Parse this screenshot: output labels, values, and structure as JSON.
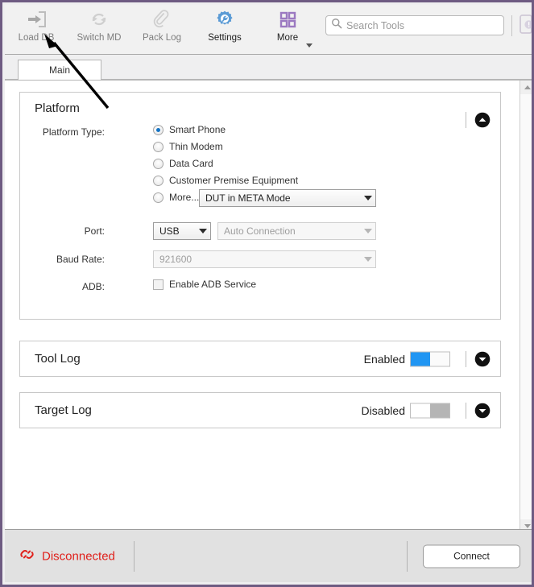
{
  "toolbar": {
    "buttons": [
      {
        "label": "Load DB",
        "icon": "import-db-icon",
        "state": "dim"
      },
      {
        "label": "Switch MD",
        "icon": "refresh-sync-icon",
        "state": "dim"
      },
      {
        "label": "Pack Log",
        "icon": "paperclip-icon",
        "state": "dim"
      },
      {
        "label": "Settings",
        "icon": "gear-wrench-icon",
        "state": "dark"
      },
      {
        "label": "More",
        "icon": "grid-squares-icon",
        "state": "dark"
      }
    ],
    "search": {
      "value": "",
      "placeholder": "Search Tools",
      "icon": "search-icon"
    },
    "device_icon": "device-status-icon"
  },
  "tabs": [
    {
      "label": "Main",
      "active": true
    }
  ],
  "platform": {
    "title": "Platform",
    "collapse_icon": "chevron-up-circle-icon",
    "platform_type_label": "Platform Type:",
    "options": [
      {
        "label": "Smart Phone",
        "selected": true
      },
      {
        "label": "Thin Modem",
        "selected": false
      },
      {
        "label": "Data Card",
        "selected": false
      },
      {
        "label": "Customer Premise Equipment",
        "selected": false
      },
      {
        "label": "More...",
        "selected": false
      }
    ],
    "more_combo": {
      "value": "DUT in META Mode",
      "disabled": false
    },
    "port_label": "Port:",
    "port_combo": {
      "value": "USB",
      "disabled": false
    },
    "connection_combo": {
      "value": "Auto Connection",
      "disabled": true
    },
    "baud_label": "Baud Rate:",
    "baud_combo": {
      "value": "921600",
      "disabled": true
    },
    "adb_label": "ADB:",
    "adb_checkbox": {
      "label": "Enable ADB Service",
      "checked": false
    }
  },
  "tool_log": {
    "title": "Tool Log",
    "state_label": "Enabled",
    "enabled": true,
    "collapse_icon": "chevron-down-circle-icon"
  },
  "target_log": {
    "title": "Target Log",
    "state_label": "Disabled",
    "enabled": false,
    "collapse_icon": "chevron-down-circle-icon"
  },
  "footer": {
    "status_text": "Disconnected",
    "status_icon": "broken-link-icon",
    "status_color": "#e0201b",
    "connect_label": "Connect"
  },
  "colors": {
    "window_border": "#6e5b82",
    "accent_blue": "#2196f3",
    "settings_blue": "#5b9bd5",
    "more_purple": "#9b79c1"
  }
}
